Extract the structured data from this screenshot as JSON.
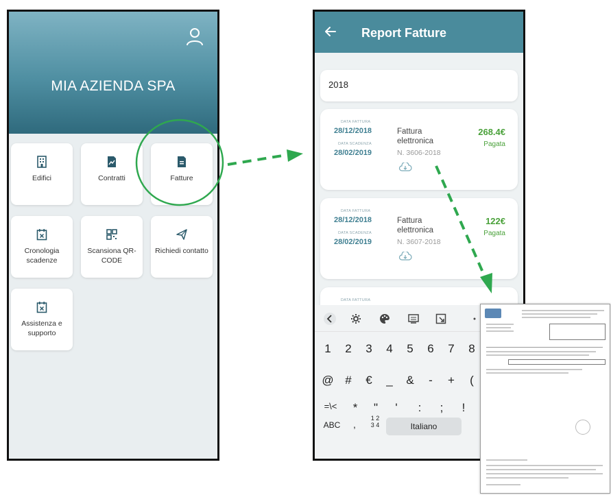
{
  "left_phone": {
    "company_name": "MIA AZIENDA SPA",
    "tiles": [
      {
        "label": "Edifici",
        "icon": "building-icon"
      },
      {
        "label": "Contratti",
        "icon": "contract-document-icon"
      },
      {
        "label": "Fatture",
        "icon": "invoice-document-icon"
      },
      {
        "label": "Cronologia scadenze",
        "icon": "calendar-x-icon"
      },
      {
        "label": "Scansiona QR-CODE",
        "icon": "qr-code-icon"
      },
      {
        "label": "Richiedi contatto",
        "icon": "paper-plane-icon"
      },
      {
        "label": "Assistenza e supporto",
        "icon": "calendar-x-icon"
      }
    ]
  },
  "right_phone": {
    "title": "Report Fatture",
    "search_value": "2018",
    "invoices": [
      {
        "date_label": "DATA FATTURA",
        "date": "28/12/2018",
        "due_label": "DATA SCADENZA",
        "due_date": "28/02/2019",
        "description": "Fattura elettronica",
        "number": "N. 3606-2018",
        "amount": "268.4€",
        "status": "Pagata"
      },
      {
        "date_label": "DATA FATTURA",
        "date": "28/12/2018",
        "due_label": "DATA SCADENZA",
        "due_date": "28/02/2019",
        "description": "Fattura elettronica",
        "number": "N. 3607-2018",
        "amount": "122€",
        "status": "Pagata"
      },
      {
        "date_label": "DATA FATTURA"
      }
    ],
    "keyboard": {
      "row1": [
        "1",
        "2",
        "3",
        "4",
        "5",
        "6",
        "7",
        "8"
      ],
      "row2": [
        "@",
        "#",
        "€",
        "_",
        "&",
        "-",
        "+",
        "("
      ],
      "row3": [
        "=\\<",
        "*",
        "\"",
        "'",
        ":",
        ";",
        "!"
      ],
      "abc": "ABC",
      "comma": ",",
      "numkey_top": "1 2",
      "numkey_bottom": "3 4",
      "space": "Italiano"
    }
  },
  "colors": {
    "header_teal": "#4a8b9c",
    "accent_green": "#2fa84f",
    "amount_green": "#4aa13a",
    "date_teal": "#3f7f91"
  }
}
